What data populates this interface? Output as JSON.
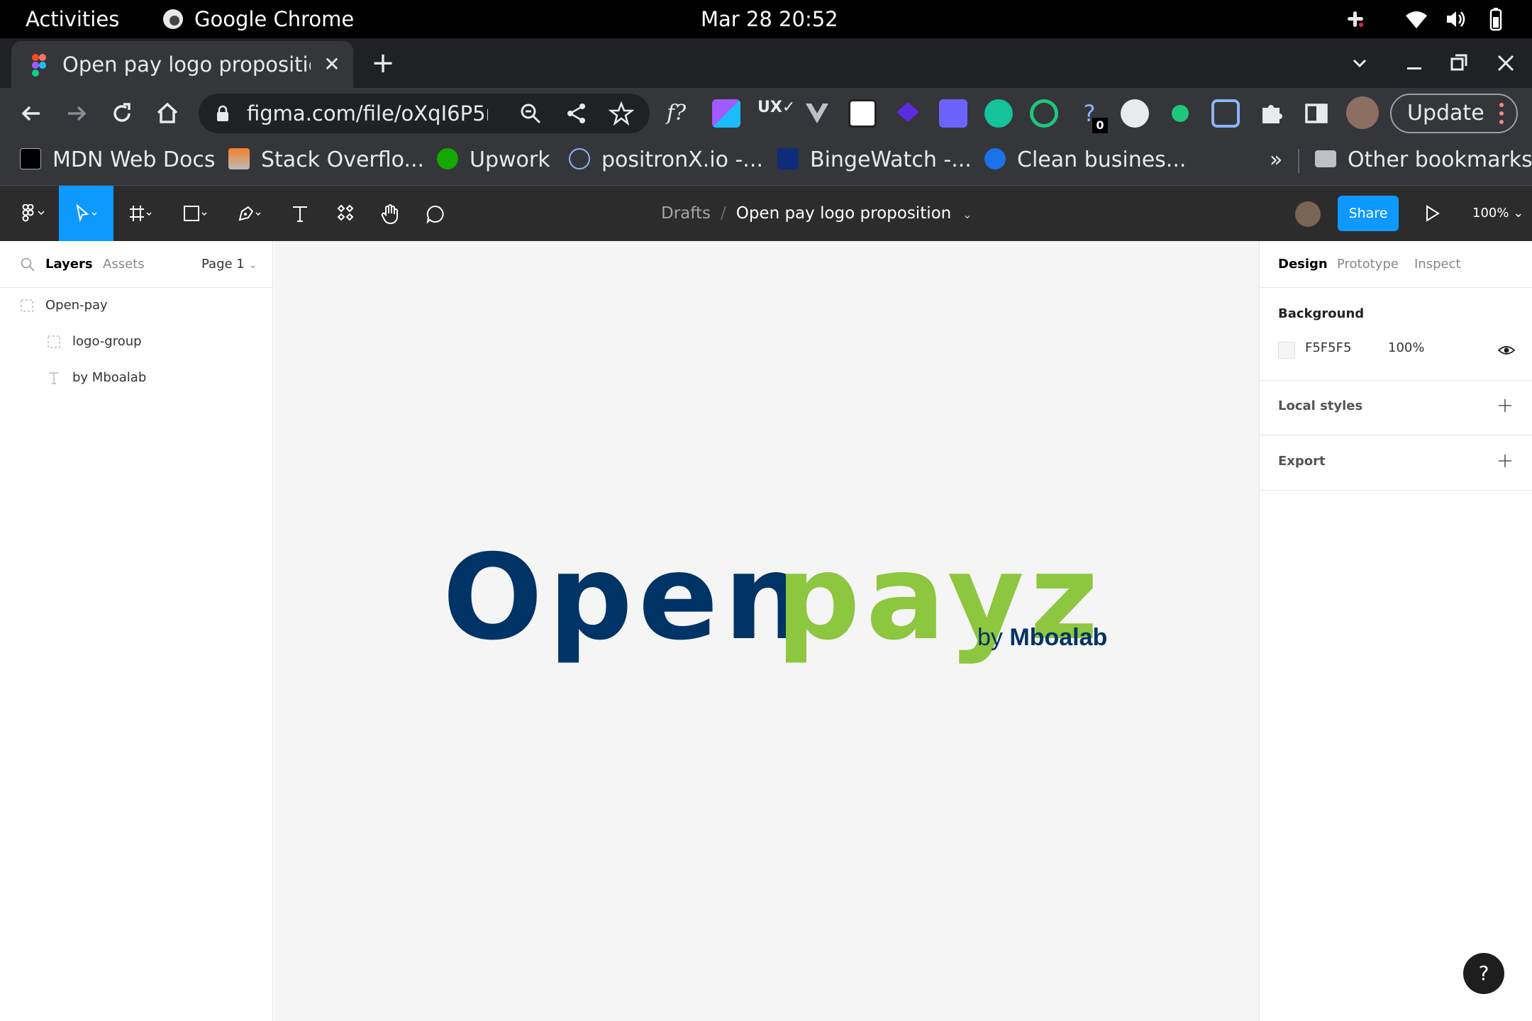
{
  "system_bar": {
    "activities": "Activities",
    "app_name": "Google Chrome",
    "clock": "Mar 28  20:52"
  },
  "browser": {
    "tab_title": "Open pay logo proposition",
    "url": "figma.com/file/oXqI6P5m...",
    "update_label": "Update",
    "bookmarks": [
      {
        "label": "MDN Web Docs",
        "icon": "mdn-icon"
      },
      {
        "label": "Stack Overflo...",
        "icon": "stackoverflow-icon"
      },
      {
        "label": "Upwork",
        "icon": "upwork-icon"
      },
      {
        "label": "positronX.io -...",
        "icon": "react-icon"
      },
      {
        "label": "BingeWatch -...",
        "icon": "bingewatch-icon"
      },
      {
        "label": "Clean busines...",
        "icon": "robot-icon"
      }
    ],
    "bookmarks_more": "»",
    "other_bookmarks": "Other bookmarks",
    "extensions_badge": "0"
  },
  "figma": {
    "breadcrumb": {
      "project": "Drafts",
      "separator": "/",
      "file": "Open pay logo proposition"
    },
    "share_label": "Share",
    "zoom": "100%",
    "left_panel": {
      "tab_layers": "Layers",
      "tab_assets": "Assets",
      "page": "Page 1",
      "layers": [
        {
          "name": "Open-pay",
          "type": "frame"
        },
        {
          "name": "logo-group",
          "type": "group"
        },
        {
          "name": "by Mboalab",
          "type": "text"
        }
      ]
    },
    "canvas": {
      "logo_part1": "Open",
      "logo_part2": "payz",
      "tagline_by": "by",
      "tagline_name": "Mboalab",
      "colors": {
        "navy": "#003366",
        "green": "#8dc63f",
        "background": "#F5F5F5"
      }
    },
    "right_panel": {
      "tab_design": "Design",
      "tab_prototype": "Prototype",
      "tab_inspect": "Inspect",
      "background_title": "Background",
      "background_hex": "F5F5F5",
      "background_opacity": "100%",
      "local_styles": "Local styles",
      "export": "Export"
    },
    "help": "?"
  }
}
